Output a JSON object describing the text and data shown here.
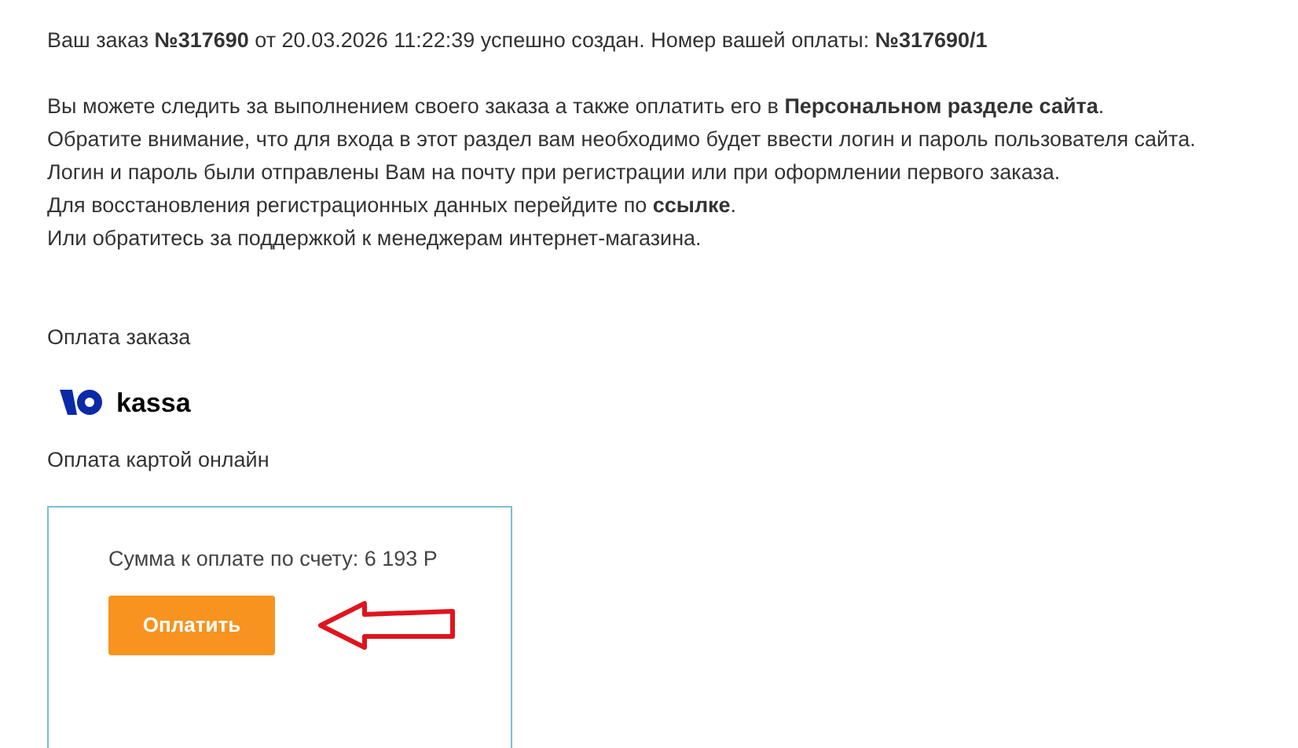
{
  "order_line": "Ваш заказ **№317690** от 20.03.2026 11:22:39 успешно создан. Номер вашей оплаты: **№317690/1**",
  "info": [
    {
      "kind": "link",
      "before": "Вы можете следить за выполнением своего заказа а также оплатить его в ",
      "link": "Персональном разделе сайта",
      "after": "."
    },
    {
      "kind": "text",
      "text": "Обратите внимание, что для входа в этот раздел вам необходимо будет ввести логин и пароль пользователя сайта."
    },
    {
      "kind": "text",
      "text": "Логин и пароль были отправлены Вам на почту при регистрации или при оформлении первого заказа."
    },
    {
      "kind": "link",
      "before": "Для восстановления регистрационных данных перейдите по ",
      "link": "ссылке",
      "after": "."
    },
    {
      "kind": "text",
      "text": "Или обратитесь за поддержкой к менеджерам интернет-магазина."
    }
  ],
  "payment_heading": "Оплата заказа",
  "logo_text": "kassa",
  "method": "Оплата картой онлайн",
  "card": {
    "amount": "Сумма к оплате по счету: 6 193 Р",
    "button": "Оплатить"
  }
}
